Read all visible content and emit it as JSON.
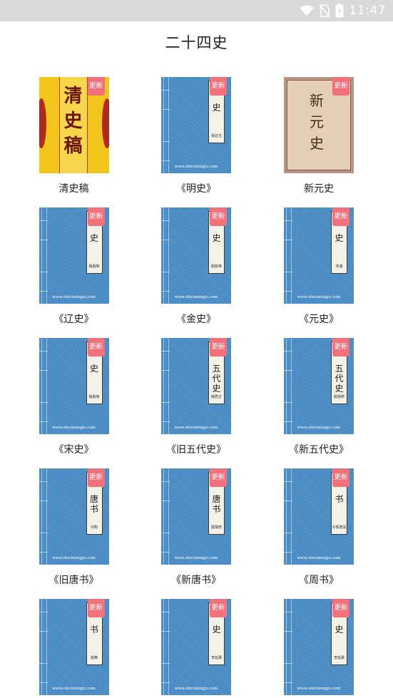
{
  "status_bar": {
    "time": "11:47"
  },
  "header": {
    "title": "二十四史"
  },
  "badge_label": "更新",
  "cover_url": "www.shicimingju.com",
  "books": [
    {
      "title": "清史稿",
      "cover": "yellow",
      "cover_title": "清史稿"
    },
    {
      "title": "《明史》",
      "cover": "blue",
      "strip": "史",
      "author": "張廷玉"
    },
    {
      "title": "新元史",
      "cover": "tan",
      "cover_title": "新元史"
    },
    {
      "title": "《辽史》",
      "cover": "blue",
      "strip": "史",
      "author": "脫脫等"
    },
    {
      "title": "《金史》",
      "cover": "blue",
      "strip": "史",
      "author": "脫脫等"
    },
    {
      "title": "《元史》",
      "cover": "blue",
      "strip": "史",
      "author": "宋濂"
    },
    {
      "title": "《宋史》",
      "cover": "blue",
      "strip": "史",
      "author": "脫脫等"
    },
    {
      "title": "《旧五代史》",
      "cover": "blue",
      "strip": "五代史",
      "author": "薛居正"
    },
    {
      "title": "《新五代史》",
      "cover": "blue",
      "strip": "五代史",
      "author": "歐陽修"
    },
    {
      "title": "《旧唐书》",
      "cover": "blue",
      "strip": "唐书",
      "author": "刘昫"
    },
    {
      "title": "《新唐书》",
      "cover": "blue",
      "strip": "唐书",
      "author": "歐陽修"
    },
    {
      "title": "《周书》",
      "cover": "blue",
      "strip": "书",
      "author": "令狐德棻"
    },
    {
      "title": "",
      "cover": "blue",
      "strip": "书",
      "author": "姚察"
    },
    {
      "title": "",
      "cover": "blue",
      "strip": "史",
      "author": "李延壽"
    },
    {
      "title": "",
      "cover": "blue",
      "strip": "史",
      "author": "李延壽"
    }
  ]
}
